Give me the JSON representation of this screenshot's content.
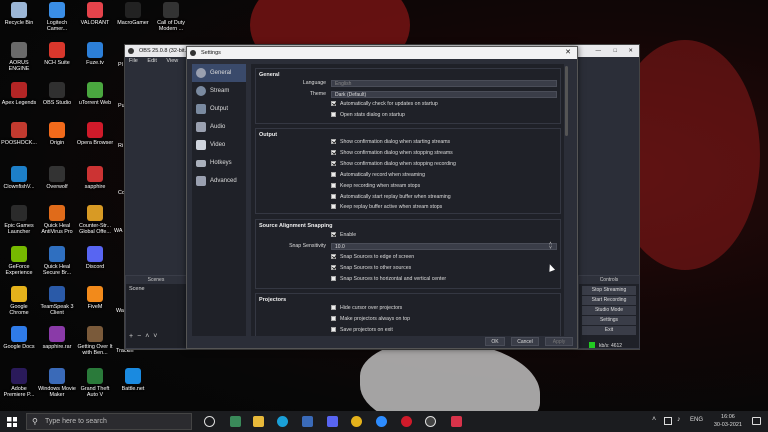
{
  "desktop": {
    "icons": [
      {
        "label": "Recycle Bin",
        "color": "#9bb6d6"
      },
      {
        "label": "Logitech Camer...",
        "color": "#3a8ee6"
      },
      {
        "label": "VALORANT",
        "color": "#e5434b"
      },
      {
        "label": "MacroGamer",
        "color": "#222222"
      },
      {
        "label": "Call of Duty Modern ...",
        "color": "#333333"
      },
      {
        "label": "AORUS ENGINE",
        "color": "#6a6a6a"
      },
      {
        "label": "NCH Suite",
        "color": "#d8372c"
      },
      {
        "label": "Fuze.tv",
        "color": "#2c7fd8"
      },
      {
        "label": "Apex Legends",
        "color": "#b32525"
      },
      {
        "label": "OBS Studio",
        "color": "#303030"
      },
      {
        "label": "uTorrent Web",
        "color": "#4aa73f"
      },
      {
        "label": "POOSHOCK...",
        "color": "#c23a2f"
      },
      {
        "label": "Origin",
        "color": "#f26a1b"
      },
      {
        "label": "Opera Browser",
        "color": "#d01a2a"
      },
      {
        "label": "ClownfishV...",
        "color": "#1d7fc8"
      },
      {
        "label": "Overwolf",
        "color": "#333333"
      },
      {
        "label": "sapphire",
        "color": "#cc3333"
      },
      {
        "label": "Epic Games Launcher",
        "color": "#2b2b2b"
      },
      {
        "label": "Quick Heal AntiVirus Pro",
        "color": "#e06b1a"
      },
      {
        "label": "Counter-Str... Global Offe...",
        "color": "#d89a24"
      },
      {
        "label": "GeForce Experience",
        "color": "#76b900"
      },
      {
        "label": "Quick Heal Secure Br...",
        "color": "#2f6fc0"
      },
      {
        "label": "Discord",
        "color": "#5865f2"
      },
      {
        "label": "Google Chrome",
        "color": "#e5b21b"
      },
      {
        "label": "TeamSpeak 3 Client",
        "color": "#2a5aa8"
      },
      {
        "label": "FiveM",
        "color": "#f28a1b"
      },
      {
        "label": "Google Docs",
        "color": "#2f7be8"
      },
      {
        "label": "sapphire.rar",
        "color": "#8a3aa8"
      },
      {
        "label": "Getting Over It with Ben...",
        "color": "#7a5a3a"
      },
      {
        "label": "Adobe Premiere P...",
        "color": "#2a1a5a"
      },
      {
        "label": "Windows Movie Maker",
        "color": "#3a6ab8"
      },
      {
        "label": "Grand Theft Auto V",
        "color": "#2a7a3a"
      },
      {
        "label": "Battle.net",
        "color": "#1a8ae0"
      }
    ],
    "partial_labels": [
      "Pl",
      "Pu",
      "Ri Gi",
      "Co",
      "WA",
      "Wa",
      "Trackin"
    ]
  },
  "obs": {
    "title": "OBS 25.0.8 (32-bit...",
    "menu": [
      "File",
      "Edit",
      "View",
      "Pr"
    ],
    "scenes_label": "Scenes",
    "scene_item": "Scene",
    "controls_label": "Controls",
    "controls": [
      "Stop Streaming",
      "Start Recording",
      "Studio Mode",
      "Settings",
      "Exit"
    ],
    "status": "kb/s: 4612",
    "status_color": "#22cc22"
  },
  "settings": {
    "title": "Settings",
    "sidebar": [
      "General",
      "Stream",
      "Output",
      "Audio",
      "Video",
      "Hotkeys",
      "Advanced"
    ],
    "general": {
      "header": "General",
      "language_label": "Language",
      "language_value": "English",
      "theme_label": "Theme",
      "theme_value": "Dark (Default)",
      "checks": [
        {
          "label": "Automatically check for updates on startup",
          "checked": true
        },
        {
          "label": "Open stats dialog on startup",
          "checked": false
        }
      ]
    },
    "output": {
      "header": "Output",
      "checks": [
        {
          "label": "Show confirmation dialog when starting streams",
          "checked": true
        },
        {
          "label": "Show confirmation dialog when stopping streams",
          "checked": true
        },
        {
          "label": "Show confirmation dialog when stopping recording",
          "checked": true
        },
        {
          "label": "Automatically record when streaming",
          "checked": false
        },
        {
          "label": "Keep recording when stream stops",
          "checked": false
        },
        {
          "label": "Automatically start replay buffer when streaming",
          "checked": false
        },
        {
          "label": "Keep replay buffer active when stream stops",
          "checked": false
        }
      ]
    },
    "snapping": {
      "header": "Source Alignment Snapping",
      "enable": {
        "label": "Enable",
        "checked": true
      },
      "sensitivity_label": "Snap Sensitivity",
      "sensitivity_value": "10.0",
      "checks": [
        {
          "label": "Snap Sources to edge of screen",
          "checked": true
        },
        {
          "label": "Snap Sources to other sources",
          "checked": true
        },
        {
          "label": "Snap Sources to horizontal and vertical center",
          "checked": false
        }
      ]
    },
    "projectors": {
      "header": "Projectors",
      "checks": [
        {
          "label": "Hide cursor over projectors",
          "checked": false
        },
        {
          "label": "Make projectors always on top",
          "checked": false
        },
        {
          "label": "Save projectors on exit",
          "checked": false
        }
      ]
    },
    "buttons": {
      "ok": "OK",
      "cancel": "Cancel",
      "apply": "Apply"
    }
  },
  "taskbar": {
    "search_placeholder": "Type here to search",
    "lang": "ENG",
    "time": "16:06",
    "date": "30-03-2021"
  }
}
